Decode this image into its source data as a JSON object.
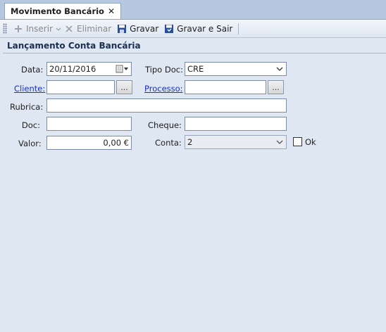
{
  "tab": {
    "title": "Movimento Bancário",
    "close": "✕"
  },
  "toolbar": {
    "insert": "Inserir",
    "delete": "Eliminar",
    "save": "Gravar",
    "save_exit": "Gravar e Sair"
  },
  "section": {
    "title": "Lançamento Conta Bancária"
  },
  "form": {
    "data_label": "Data:",
    "data_value": "20/11/2016",
    "tipo_label": "Tipo Doc:",
    "tipo_value": "CRE",
    "cliente_label": "Cliente:",
    "cliente_value": "",
    "cliente_btn": "...",
    "processo_label": "Processo:",
    "processo_value": "",
    "processo_btn": "...",
    "rubrica_label": "Rubrica:",
    "rubrica_value": "",
    "doc_label": "Doc:",
    "doc_value": "",
    "cheque_label": "Cheque:",
    "cheque_value": "",
    "valor_label": "Valor:",
    "valor_value": "0,00 €",
    "conta_label": "Conta:",
    "conta_value": "2",
    "ok_label": "Ok"
  },
  "colors": {
    "background": "#dfe7f3",
    "link": "#1a30c8",
    "tabstrip": "#b6c8e0"
  },
  "icons": [
    "plus-icon",
    "chevron-down-icon",
    "x-icon",
    "floppy-icon",
    "floppy-exit-icon",
    "calendar-icon"
  ]
}
